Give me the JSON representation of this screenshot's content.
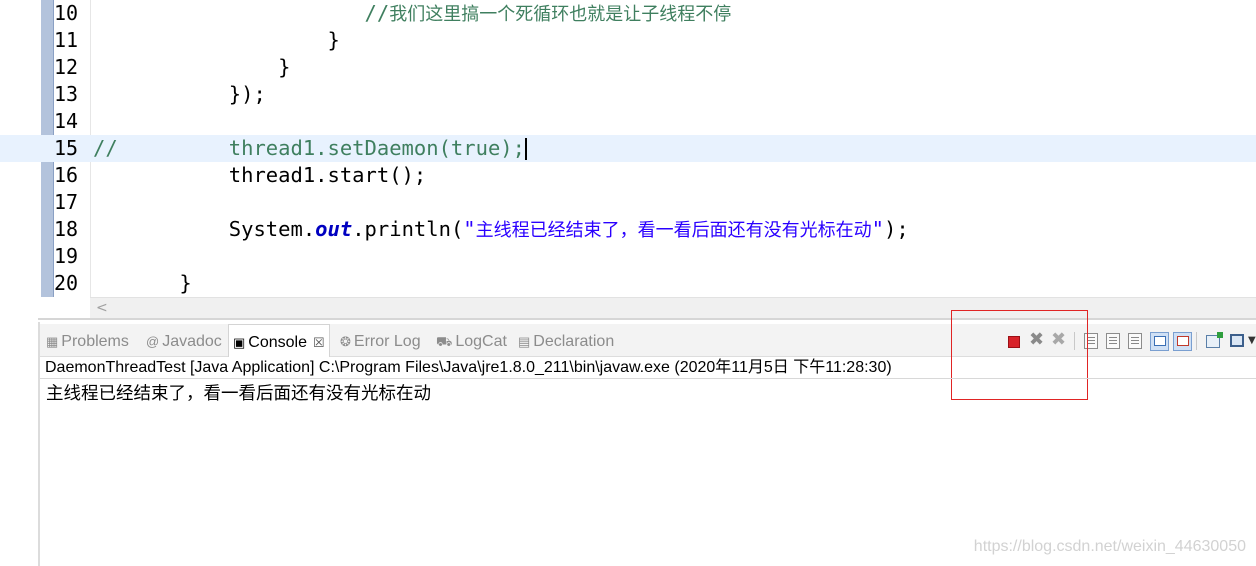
{
  "editor": {
    "lines": [
      {
        "num": "10",
        "parts": [
          {
            "text": "                      ",
            "t": ""
          },
          {
            "text": "//",
            "t": "tok-comment"
          },
          {
            "text": "我们这里搞一个死循环也就是让子线程不停",
            "t": "tok-comment-cn"
          }
        ]
      },
      {
        "num": "11",
        "parts": [
          {
            "text": "                   }",
            "t": ""
          }
        ]
      },
      {
        "num": "12",
        "parts": [
          {
            "text": "               }",
            "t": ""
          }
        ]
      },
      {
        "num": "13",
        "parts": [
          {
            "text": "           });",
            "t": ""
          }
        ]
      },
      {
        "num": "14",
        "parts": []
      },
      {
        "num": "15",
        "current": true,
        "parts": [
          {
            "text": "//",
            "t": "tok-comment"
          },
          {
            "text": "         thread1.setDaemon(true);",
            "t": "tok-comment"
          }
        ]
      },
      {
        "num": "16",
        "parts": [
          {
            "text": "           thread1.start();",
            "t": ""
          }
        ]
      },
      {
        "num": "17",
        "parts": []
      },
      {
        "num": "18",
        "parts": [
          {
            "text": "           System.",
            "t": ""
          },
          {
            "text": "out",
            "t": "tok-field"
          },
          {
            "text": ".println(",
            "t": ""
          },
          {
            "text": "\"",
            "t": "tok-string"
          },
          {
            "text": "主线程已经结束了，看一看后面还有没有光标在动",
            "t": "tok-string-cn"
          },
          {
            "text": "\"",
            "t": "tok-string"
          },
          {
            "text": ");",
            "t": ""
          }
        ]
      },
      {
        "num": "19",
        "parts": []
      },
      {
        "num": "20",
        "parts": [
          {
            "text": "       }",
            "t": ""
          }
        ]
      }
    ],
    "scroll_arrow": "<"
  },
  "tabs": [
    {
      "label": "Problems",
      "icon": "▦",
      "icon_name": "problems-icon",
      "active": false
    },
    {
      "label": "Javadoc",
      "icon": "@",
      "icon_name": "javadoc-icon",
      "active": false
    },
    {
      "label": "Console",
      "icon": "▣",
      "icon_name": "console-icon",
      "active": true,
      "close": "☒"
    },
    {
      "label": "Error Log",
      "icon": "❂",
      "icon_name": "error-log-icon",
      "active": false
    },
    {
      "label": "LogCat",
      "icon": "⛟",
      "icon_name": "logcat-icon",
      "active": false
    },
    {
      "label": "Declaration",
      "icon": "▤",
      "icon_name": "declaration-icon",
      "active": false
    }
  ],
  "toolbar": {
    "terminate_icon": "terminate-icon",
    "remove_glyph": "✖",
    "remove_all_glyph": "✖"
  },
  "console": {
    "launch_info": "DaemonThreadTest [Java Application] C:\\Program Files\\Java\\jre1.8.0_211\\bin\\javaw.exe (2020年11月5日 下午11:28:30)",
    "output": "主线程已经结束了，看一看后面还有没有光标在动"
  },
  "watermark": "https://blog.csdn.net/weixin_44630050",
  "colors": {
    "highlight_box": "#e02424",
    "terminate": "#d8232a"
  }
}
